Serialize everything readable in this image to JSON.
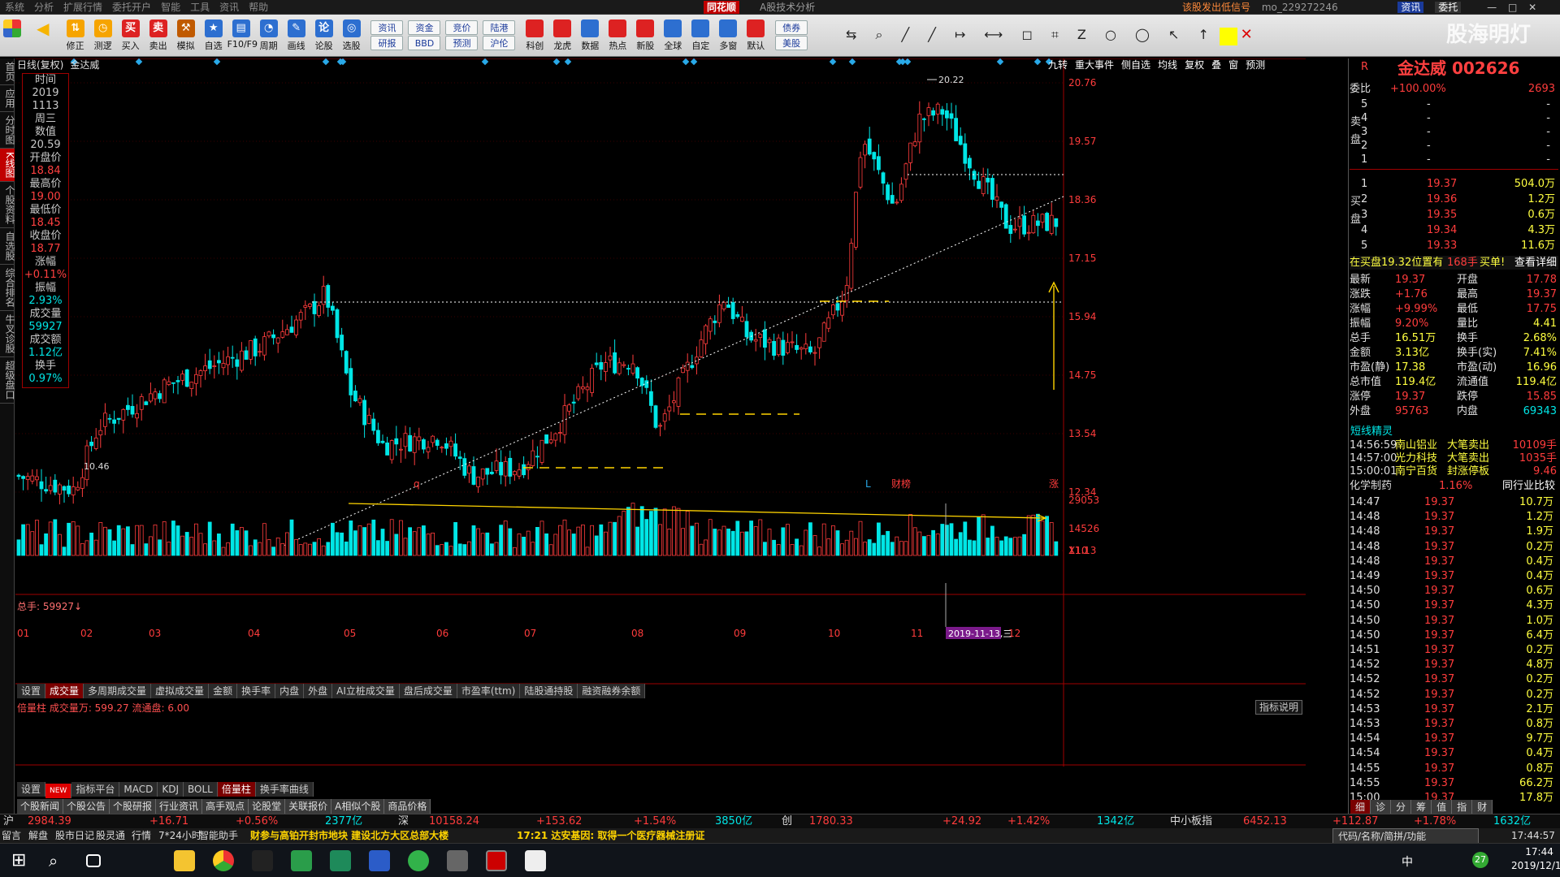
{
  "menu": [
    "系统",
    "分析",
    "扩展行情",
    "委托开户",
    "智能",
    "工具",
    "资讯",
    "帮助"
  ],
  "app_name": "同花顺",
  "app_title": "A股技术分析",
  "top_right": {
    "notice": "该股发出低信号",
    "user": "mo_229272246",
    "info": "资讯",
    "entrust": "委托"
  },
  "toolbar": [
    {
      "label": "修正",
      "icon": "arrows-icon"
    },
    {
      "label": "测逻",
      "icon": "clock-icon"
    },
    {
      "label": "买入",
      "icon": "buy-icon"
    },
    {
      "label": "卖出",
      "icon": "sell-icon"
    },
    {
      "label": "模拟",
      "icon": "hammer-icon"
    },
    {
      "label": "自选",
      "icon": "star-icon"
    },
    {
      "label": "F10/F9",
      "icon": "doc-icon"
    },
    {
      "label": "周期",
      "icon": "period-icon"
    },
    {
      "label": "画线",
      "icon": "pen-icon"
    },
    {
      "label": "论股",
      "icon": "talk-icon"
    },
    {
      "label": "选股",
      "icon": "select-icon"
    }
  ],
  "toolbar_pairs": [
    [
      "资讯",
      "研报"
    ],
    [
      "资金",
      "BBD"
    ],
    [
      "竞价",
      "预测"
    ],
    [
      "陆港",
      "沪伦"
    ]
  ],
  "toolbar2": [
    {
      "label": "科创"
    },
    {
      "label": "龙虎"
    },
    {
      "label": "数据"
    },
    {
      "label": "热点"
    },
    {
      "label": "新股"
    },
    {
      "label": "全球"
    },
    {
      "label": "自定"
    },
    {
      "label": "多窗"
    },
    {
      "label": "默认"
    }
  ],
  "toolbar_bonds": [
    "债券",
    "美股"
  ],
  "watermark": "股海明灯",
  "leftnav": [
    "首页",
    "应用",
    "分时图",
    "K线图",
    "个股资料",
    "自选股",
    "综合排名",
    "牛叉诊股",
    "超级盘口"
  ],
  "chart": {
    "period": "日线(复权)",
    "name": "金达威",
    "buttons": [
      "九转",
      "重大事件",
      "侧自选",
      "均线",
      "复权",
      "叠",
      "窗",
      "预测"
    ],
    "price_ticks": [
      "20.76",
      "19.57",
      "18.36",
      "17.15",
      "15.94",
      "14.75",
      "13.54",
      "12.34",
      "11.13"
    ],
    "high_label": "20.22",
    "low_label": "10.46",
    "markers": [
      "q",
      "L",
      "财榜",
      "涨"
    ],
    "vol_ticks": [
      "29053",
      "14526",
      "X10"
    ],
    "months": [
      "01",
      "02",
      "03",
      "04",
      "05",
      "06",
      "07",
      "08",
      "09",
      "10",
      "11",
      "12"
    ],
    "cursor_date": "2019-11-13,三"
  },
  "infobox": [
    {
      "k": "时间",
      "v": "2019"
    },
    {
      "k": "",
      "v": "1113"
    },
    {
      "k": "",
      "v": "周三"
    },
    {
      "k": "数值",
      "v": "20.59"
    },
    {
      "k": "开盘价",
      "v": "18.84"
    },
    {
      "k": "最高价",
      "v": "19.00"
    },
    {
      "k": "最低价",
      "v": "18.45"
    },
    {
      "k": "收盘价",
      "v": "18.77"
    },
    {
      "k": "涨幅",
      "v": "+0.11%"
    },
    {
      "k": "振幅",
      "v": "2.93%"
    },
    {
      "k": "成交量",
      "v": "59927"
    },
    {
      "k": "成交额",
      "v": "1.12亿"
    },
    {
      "k": "换手",
      "v": "0.97%"
    }
  ],
  "volume": {
    "header": "总手: 59927↓",
    "tabs": [
      "设置",
      "成交量",
      "多周期成交量",
      "虚拟成交量",
      "金额",
      "换手率",
      "内盘",
      "外盘",
      "AI立桩成交量",
      "盘后成交量",
      "市盈率(ttm)",
      "陆股通持股",
      "融资融券余额"
    ]
  },
  "indicator": {
    "header": "倍量柱 成交量万: 599.27 流通盘: 6.00",
    "button": "指标说明"
  },
  "bottom_tabs": [
    "设置",
    "NEW",
    "指标平台",
    "MACD",
    "KDJ",
    "BOLL",
    "倍量柱",
    "换手率曲线"
  ],
  "news_tabs": [
    "个股新闻",
    "个股公告",
    "个股研报",
    "行业资讯",
    "高手观点",
    "论股堂",
    "关联报价",
    "A相似个股",
    "商品价格"
  ],
  "right": {
    "code_name": "金达威 002626",
    "tag": "R",
    "weibi": {
      "k": "委比",
      "v": "+100.00%",
      "v2": "2693"
    },
    "sell": [
      {
        "lvl": "5",
        "p": "-",
        "q": "-"
      },
      {
        "lvl": "4",
        "p": "-",
        "q": "-"
      },
      {
        "lvl": "3",
        "p": "-",
        "q": "-"
      },
      {
        "lvl": "2",
        "p": "-",
        "q": "-"
      },
      {
        "lvl": "1",
        "p": "-",
        "q": "-"
      }
    ],
    "buy": [
      {
        "lvl": "1",
        "p": "19.37",
        "q": "504.0万"
      },
      {
        "lvl": "2",
        "p": "19.36",
        "q": "1.2万"
      },
      {
        "lvl": "3",
        "p": "19.35",
        "q": "0.6万"
      },
      {
        "lvl": "4",
        "p": "19.34",
        "q": "4.3万"
      },
      {
        "lvl": "5",
        "p": "19.33",
        "q": "11.6万"
      }
    ],
    "sell_label": "卖盘",
    "buy_label": "买盘",
    "notice": {
      "a": "在买盘19.32位置有",
      "b": "168手",
      "c": "买单!",
      "d": "查看详细"
    },
    "stats": [
      {
        "k1": "最新",
        "v1": "19.37",
        "k2": "开盘",
        "v2": "17.78"
      },
      {
        "k1": "涨跌",
        "v1": "+1.76",
        "k2": "最高",
        "v2": "19.37"
      },
      {
        "k1": "涨幅",
        "v1": "+9.99%",
        "k2": "最低",
        "v2": "17.75"
      },
      {
        "k1": "振幅",
        "v1": "9.20%",
        "k2": "量比",
        "v2": "4.41"
      },
      {
        "k1": "总手",
        "v1": "16.51万",
        "k2": "换手",
        "v2": "2.68%"
      },
      {
        "k1": "金额",
        "v1": "3.13亿",
        "k2": "换手(实)",
        "v2": "7.41%"
      },
      {
        "k1": "市盈(静)",
        "v1": "17.38",
        "k2": "市盈(动)",
        "v2": "16.96"
      },
      {
        "k1": "总市值",
        "v1": "119.4亿",
        "k2": "流通值",
        "v2": "119.4亿"
      },
      {
        "k1": "涨停",
        "v1": "19.37",
        "k2": "跌停",
        "v2": "15.85"
      },
      {
        "k1": "外盘",
        "v1": "95763",
        "k2": "内盘",
        "v2": "69343"
      }
    ],
    "elf_title": "短线精灵",
    "elf": [
      {
        "t": "14:56:59",
        "n": "南山铝业",
        "e": "大笔卖出",
        "v": "10109手"
      },
      {
        "t": "14:57:00",
        "n": "光力科技",
        "e": "大笔卖出",
        "v": "1035手"
      },
      {
        "t": "15:00:01",
        "n": "南宁百货",
        "e": "封涨停板",
        "v": "9.46"
      }
    ],
    "sector": {
      "name": "化学制药",
      "pct": "1.16%",
      "link": "同行业比较"
    },
    "ticks": [
      {
        "t": "14:47",
        "p": "19.37",
        "v": "10.7万"
      },
      {
        "t": "14:48",
        "p": "19.37",
        "v": "1.2万"
      },
      {
        "t": "14:48",
        "p": "19.37",
        "v": "1.9万"
      },
      {
        "t": "14:48",
        "p": "19.37",
        "v": "0.2万"
      },
      {
        "t": "14:48",
        "p": "19.37",
        "v": "0.4万"
      },
      {
        "t": "14:49",
        "p": "19.37",
        "v": "0.4万"
      },
      {
        "t": "14:50",
        "p": "19.37",
        "v": "0.6万"
      },
      {
        "t": "14:50",
        "p": "19.37",
        "v": "4.3万"
      },
      {
        "t": "14:50",
        "p": "19.37",
        "v": "1.0万"
      },
      {
        "t": "14:50",
        "p": "19.37",
        "v": "6.4万"
      },
      {
        "t": "14:51",
        "p": "19.37",
        "v": "0.2万"
      },
      {
        "t": "14:52",
        "p": "19.37",
        "v": "4.8万"
      },
      {
        "t": "14:52",
        "p": "19.37",
        "v": "0.2万"
      },
      {
        "t": "14:52",
        "p": "19.37",
        "v": "0.2万"
      },
      {
        "t": "14:53",
        "p": "19.37",
        "v": "2.1万"
      },
      {
        "t": "14:53",
        "p": "19.37",
        "v": "0.8万"
      },
      {
        "t": "14:54",
        "p": "19.37",
        "v": "9.7万"
      },
      {
        "t": "14:54",
        "p": "19.37",
        "v": "0.4万"
      },
      {
        "t": "14:55",
        "p": "19.37",
        "v": "0.8万"
      },
      {
        "t": "14:55",
        "p": "19.37",
        "v": "66.2万"
      },
      {
        "t": "15:00",
        "p": "19.37",
        "v": "17.8万"
      }
    ],
    "bottom_tabs": [
      "细",
      "诊",
      "分",
      "筹",
      "值",
      "指",
      "财"
    ]
  },
  "indices": [
    {
      "name": "沪",
      "val": "2984.39",
      "chg": "+16.71",
      "pct": "+0.56%",
      "amt": "2377亿"
    },
    {
      "name": "深",
      "val": "10158.24",
      "chg": "+153.62",
      "pct": "+1.54%",
      "amt": "3850亿"
    },
    {
      "name": "创",
      "val": "1780.33",
      "chg": "+24.92",
      "pct": "+1.42%",
      "amt": "1342亿"
    },
    {
      "name": "中小板指",
      "val": "6452.13",
      "chg": "+112.87",
      "pct": "+1.78%",
      "amt": "1632亿"
    }
  ],
  "ticker": {
    "items": [
      "留言",
      "解盘",
      "股市日记",
      "股灵通",
      "行情",
      "7*24小时",
      "智能助手"
    ],
    "news1": "财参与高铂开封市地块 建设北方大区总部大楼",
    "news2": "17:21 达安基因: 取得一个医疗器械注册证",
    "search": "代码/名称/简拼/功能",
    "time": "17:44:57"
  },
  "taskbar": {
    "time": "17:44",
    "date": "2019/12/16",
    "lang": "中",
    "badge": "27"
  },
  "colors": {
    "up": "#ff3c3c",
    "down": "#00e6e6",
    "accent": "#c00000",
    "text": "#c8c8c8",
    "yellow": "#ffff00"
  }
}
